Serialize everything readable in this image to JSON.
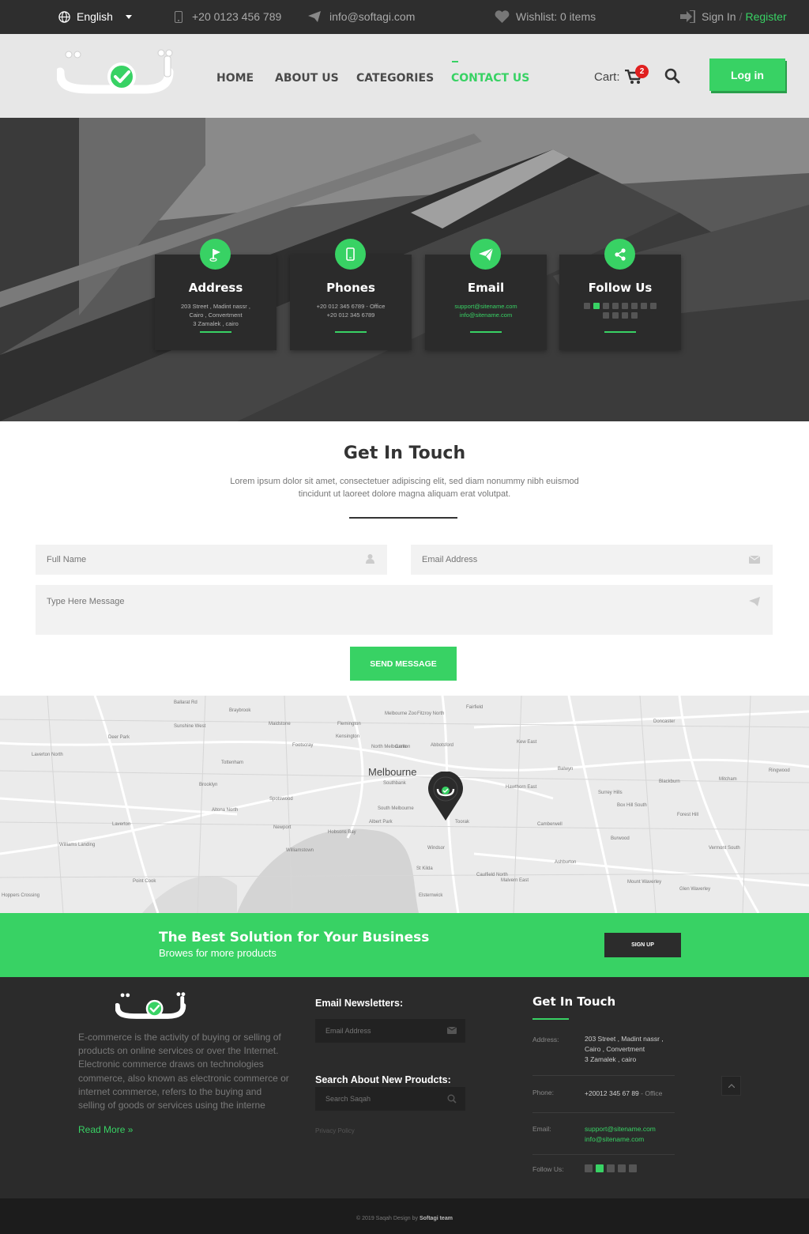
{
  "topbar": {
    "language": "English",
    "phone": "+20 0123 456 789",
    "email": "info@softagi.com",
    "wishlist": "Wishlist: 0 items",
    "sign_in": "Sign In",
    "separator": "/",
    "register": "Register"
  },
  "header": {
    "nav": [
      "HOME",
      "ABOUT US",
      "CATEGORIES",
      "CONTACT US"
    ],
    "active_nav": "CONTACT US",
    "cart_label": "Cart:",
    "cart_count": "2",
    "login": "Log in"
  },
  "info_cards": [
    {
      "title": "Address",
      "icon": "flag-icon",
      "lines": [
        "203 Street , Madint nassr ,",
        "Cairo , Convertment",
        "3 Zamalek , cairo"
      ]
    },
    {
      "title": "Phones",
      "icon": "mobile-icon",
      "lines": [
        "+20 012 345 6789 - Office",
        "+20 012 345 6789"
      ]
    },
    {
      "title": "Email",
      "icon": "paper-plane-icon",
      "lines": [
        "support@sitename.com",
        "info@sitename.com"
      ]
    },
    {
      "title": "Follow Us",
      "icon": "share-icon",
      "lines": []
    }
  ],
  "contact": {
    "title": "Get In Touch",
    "subtitle": "Lorem ipsum dolor sit amet, consectetuer adipiscing elit, sed diam nonummy nibh euismod tincidunt ut laoreet dolore magna aliquam erat volutpat.",
    "full_name_placeholder": "Full Name",
    "email_placeholder": "Email Address",
    "message_placeholder": "Type Here Message",
    "send": "SEND MESSAGE"
  },
  "map": {
    "city": "Melbourne",
    "labels": [
      "Ballarat Rd",
      "Braybrook",
      "Maidstone",
      "Footscray",
      "Tottenham",
      "Brooklyn",
      "Altona North",
      "Newport",
      "Williamstown",
      "Spotswood",
      "Flemington",
      "Kensington",
      "North Melbourne",
      "Carlton",
      "Abbotsford",
      "Southbank",
      "South Melbourne",
      "Albert Park",
      "St Kilda",
      "Windsor",
      "Toorak",
      "Hawthorn East",
      "Camberwell",
      "Balwyn",
      "Surrey Hills",
      "Box Hill South",
      "Burwood",
      "Malvern East",
      "Caulfield North",
      "Elsternwick",
      "Ashburton",
      "Forest Hill",
      "Mitcham",
      "Ringwood",
      "Vermont South",
      "Doncaster",
      "Blackburn",
      "Laverton",
      "Point Cook",
      "Hobsons Bay",
      "Mount Waverley",
      "Glen Waverley",
      "Fairfield",
      "Melbourne Zoo",
      "Fitzroy North",
      "Kew East",
      "Deer Park",
      "Sunshine West",
      "Laverton North",
      "Williams Landing",
      "Hoppers Crossing"
    ]
  },
  "cta": {
    "title": "The Best Solution for Your Business",
    "subtitle": "Browes for more products",
    "button": "SIGN UP"
  },
  "footer": {
    "description": "E-commerce is the activity of buying or selling of products on online services or over the Internet. Electronic commerce draws on technologies commerce, also known as electronic commerce or internet commerce, refers to the buying and selling of goods or services using the interne",
    "read_more": "Read More »",
    "newsletter_title": "Email Newsletters:",
    "newsletter_placeholder": "Email Address",
    "search_title": "Search About New Proudcts:",
    "search_placeholder": "Search Saqah",
    "privacy": "Privacy Policy",
    "get_in_touch": "Get In Touch",
    "address_label": "Address:",
    "address_lines": [
      "203 Street , Madint nassr ,",
      "Cairo , Convertment",
      "3 Zamalek , cairo"
    ],
    "phone_label": "Phone:",
    "phone": "+20012 345 67 89",
    "phone_suffix": "- Office",
    "email_label": "Email:",
    "emails": [
      "support@sitename.com",
      "info@sitename.com"
    ],
    "follow_label": "Follow Us:",
    "copyright": "© 2019 Saqah Design by",
    "copyright_team": "Softagi team"
  },
  "colors": {
    "accent": "#38d264",
    "dark": "#2b2b2b",
    "topbar": "#2e2e2e"
  }
}
